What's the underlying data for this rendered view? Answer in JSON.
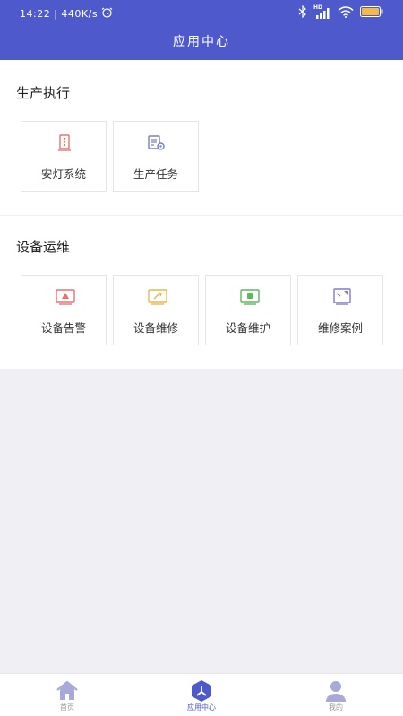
{
  "status_bar": {
    "time": "14:22",
    "speed": "440K/s",
    "network": "HD"
  },
  "header": {
    "title": "应用中心"
  },
  "sections": [
    {
      "title": "生产执行",
      "items": [
        {
          "label": "安灯系统",
          "icon": "andon-icon",
          "color": "#e57373"
        },
        {
          "label": "生产任务",
          "icon": "task-gear-icon",
          "color": "#7b7fc4"
        }
      ]
    },
    {
      "title": "设备运维",
      "items": [
        {
          "label": "设备告警",
          "icon": "alarm-icon",
          "color": "#e57373"
        },
        {
          "label": "设备维修",
          "icon": "repair-icon",
          "color": "#e6b84d"
        },
        {
          "label": "设备维护",
          "icon": "maintenance-icon",
          "color": "#5cb85c"
        },
        {
          "label": "维修案例",
          "icon": "case-icon",
          "color": "#7b7fc4"
        }
      ]
    }
  ],
  "tabbar": {
    "active_color": "#4e5acc",
    "inactive_color": "#a9a9d9",
    "items": [
      {
        "label": "首页",
        "icon": "home-icon"
      },
      {
        "label": "应用中心",
        "icon": "app-center-icon"
      },
      {
        "label": "我的",
        "icon": "profile-icon"
      }
    ]
  }
}
